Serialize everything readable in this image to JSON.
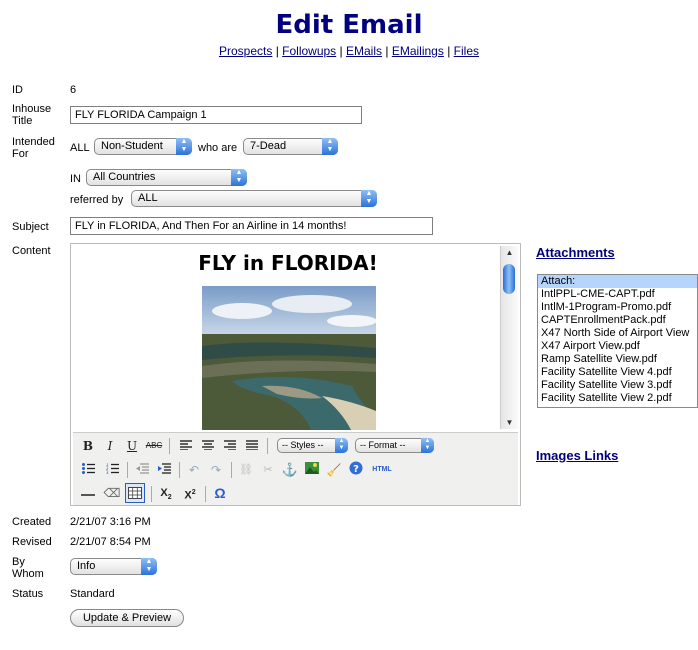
{
  "page": {
    "title": "Edit Email",
    "nav": [
      "Prospects",
      "Followups",
      "EMails",
      "EMailings",
      "Files"
    ],
    "nav_separator": "|"
  },
  "form": {
    "id_label": "ID",
    "id_value": "6",
    "inhouse_title_label_1": "Inhouse",
    "inhouse_title_label_2": "Title",
    "inhouse_title_value": "FLY FLORIDA Campaign 1",
    "intended_label_1": "Intended",
    "intended_label_2": "For",
    "all_text": "ALL",
    "audience_select": "Non-Student",
    "who_are_text": "who are",
    "status_select": "7-Dead",
    "in_text": "IN",
    "country_select": "All Countries",
    "referred_by_text": "referred by",
    "referred_select": "ALL",
    "subject_label": "Subject",
    "subject_value": "FLY in FLORIDA, And Then For an Airline in 14 months!",
    "content_label": "Content",
    "created_label": "Created",
    "created_value": "2/21/07 3:16 PM",
    "revised_label": "Revised",
    "revised_value": "2/21/07 8:54 PM",
    "by_whom_label_1": "By",
    "by_whom_label_2": "Whom",
    "by_whom_select": "Info",
    "status_label": "Status",
    "status_value": "Standard",
    "submit_button": "Update & Preview"
  },
  "editor": {
    "content_heading": "FLY in FLORIDA!",
    "styles_select": "-- Styles --",
    "format_select": "-- Format --",
    "html_button": "HTML",
    "omega_symbol": "Ω"
  },
  "attachments": {
    "heading": "Attachments",
    "items": [
      "Attach:",
      "IntlPPL-CME-CAPT.pdf",
      "IntlM-1Program-Promo.pdf",
      "CAPTEnrollmentPack.pdf",
      "X47 North Side of Airport View",
      "X47 Airport View.pdf",
      "Ramp Satellite View.pdf",
      "Facility Satellite View 4.pdf",
      "Facility Satellite View 3.pdf",
      "Facility Satellite View 2.pdf"
    ]
  },
  "images_links": {
    "heading": "Images Links"
  }
}
